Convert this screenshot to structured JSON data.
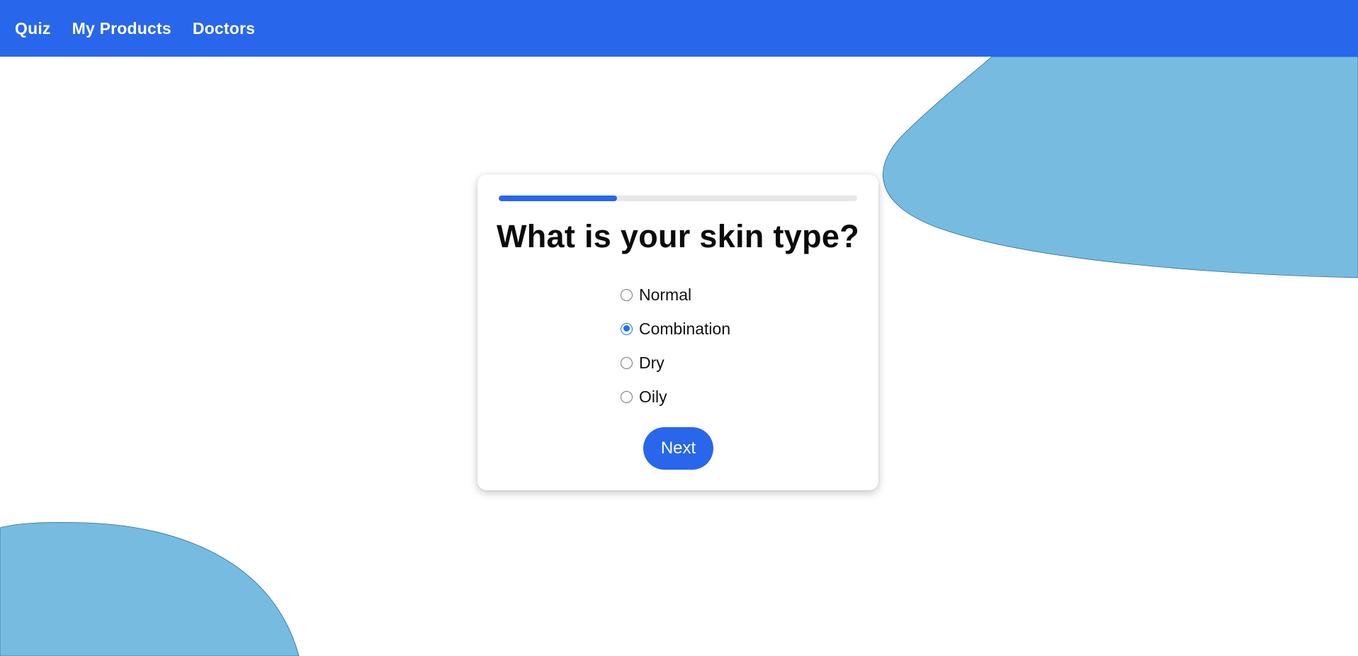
{
  "nav": {
    "items": [
      {
        "label": "Quiz"
      },
      {
        "label": "My Products"
      },
      {
        "label": "Doctors"
      }
    ]
  },
  "quiz": {
    "progress_fraction": 0.33,
    "question": "What is your skin type?",
    "options": [
      {
        "label": "Normal",
        "selected": false
      },
      {
        "label": "Combination",
        "selected": true
      },
      {
        "label": "Dry",
        "selected": false
      },
      {
        "label": "Oily",
        "selected": false
      }
    ],
    "next_label": "Next"
  },
  "colors": {
    "primary": "#2866eb",
    "blob": "#78bbe0",
    "progress_track": "#e7e7e9"
  }
}
